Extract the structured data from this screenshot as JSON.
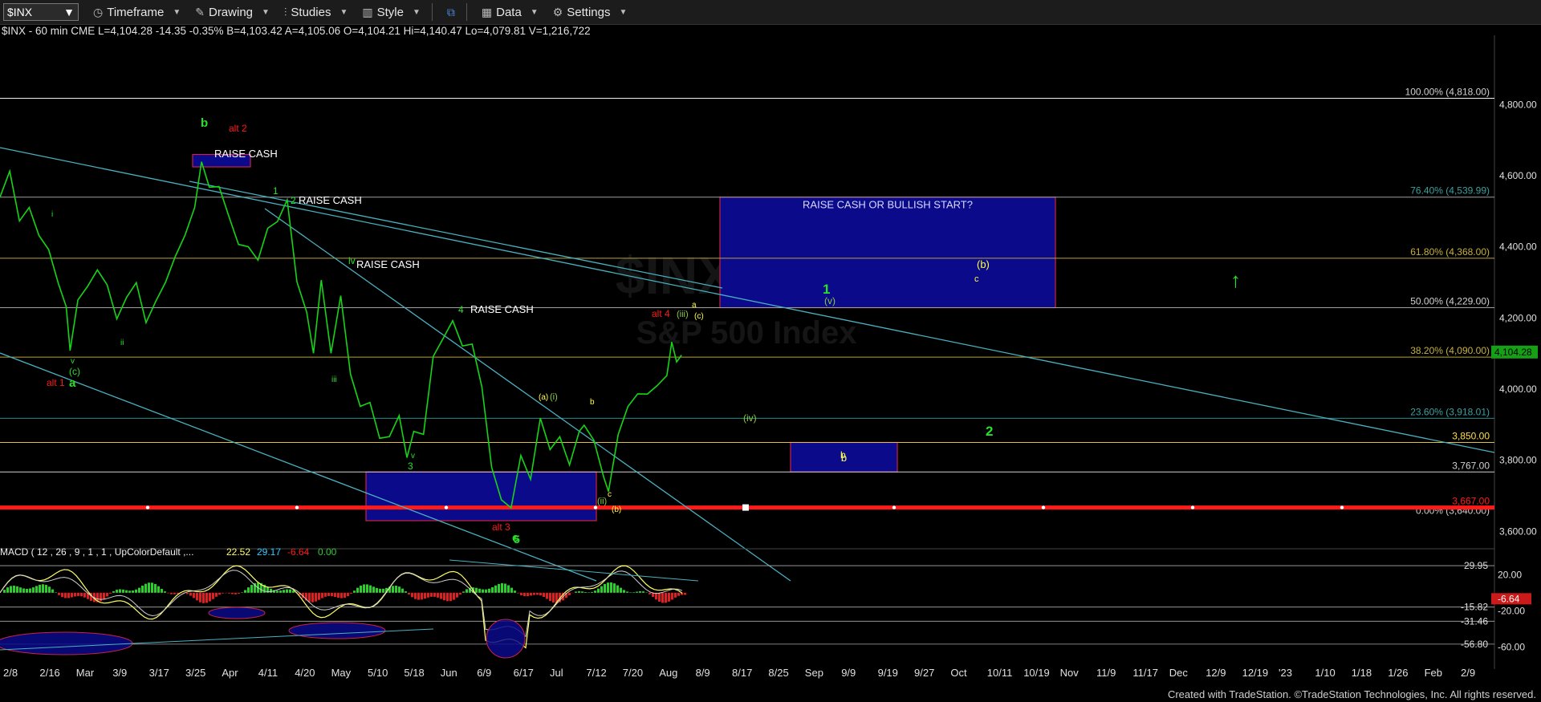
{
  "toolbar": {
    "symbol": "$INX",
    "timeframe": "Timeframe",
    "drawing": "Drawing",
    "studies": "Studies",
    "style": "Style",
    "data": "Data",
    "settings": "Settings"
  },
  "info_line": "$INX - 60 min  CME  L=4,104.28  -14.35  -0.35%  B=4,103.42  A=4,105.06  O=4,104.21  Hi=4,140.47  Lo=4,079.81  V=1,216,722",
  "watermark": {
    "symbol": "$INX",
    "name": "S&P 500 Index"
  },
  "footer": "Created with TradeStation. ©TradeStation Technologies, Inc. All rights reserved.",
  "colors": {
    "price": "#16d416",
    "fib": "#c9c9c9",
    "support": "#ffffff",
    "red": "#ff1a1a",
    "cyan": "#4ab0c0",
    "box": "#0a0a8a",
    "macd": "#e0d060",
    "hist_up": "#2bd02b",
    "hist_dn": "#e02020"
  },
  "chart_data": {
    "type": "line",
    "price_series": [
      [
        0,
        4540
      ],
      [
        10,
        4600
      ],
      [
        20,
        4480
      ],
      [
        30,
        4520
      ],
      [
        40,
        4420
      ],
      [
        50,
        4390
      ],
      [
        60,
        4310
      ],
      [
        68,
        4240
      ],
      [
        72,
        4110
      ],
      [
        80,
        4240
      ],
      [
        90,
        4300
      ],
      [
        100,
        4340
      ],
      [
        110,
        4280
      ],
      [
        120,
        4200
      ],
      [
        130,
        4270
      ],
      [
        140,
        4290
      ],
      [
        150,
        4180
      ],
      [
        160,
        4260
      ],
      [
        170,
        4300
      ],
      [
        180,
        4360
      ],
      [
        190,
        4440
      ],
      [
        200,
        4520
      ],
      [
        207,
        4640
      ],
      [
        215,
        4580
      ],
      [
        225,
        4560
      ],
      [
        235,
        4480
      ],
      [
        245,
        4420
      ],
      [
        255,
        4400
      ],
      [
        265,
        4350
      ],
      [
        275,
        4460
      ],
      [
        285,
        4480
      ],
      [
        295,
        4520
      ],
      [
        305,
        4300
      ],
      [
        315,
        4230
      ],
      [
        322,
        4110
      ],
      [
        330,
        4320
      ],
      [
        340,
        4100
      ],
      [
        350,
        4250
      ],
      [
        360,
        4050
      ],
      [
        370,
        3960
      ],
      [
        380,
        3950
      ],
      [
        390,
        3860
      ],
      [
        400,
        3880
      ],
      [
        410,
        3920
      ],
      [
        418,
        3815
      ],
      [
        425,
        3880
      ],
      [
        435,
        3860
      ],
      [
        445,
        4100
      ],
      [
        455,
        4150
      ],
      [
        465,
        4180
      ],
      [
        475,
        4120
      ],
      [
        485,
        4140
      ],
      [
        495,
        4000
      ],
      [
        505,
        3770
      ],
      [
        515,
        3700
      ],
      [
        525,
        3670
      ],
      [
        535,
        3800
      ],
      [
        545,
        3750
      ],
      [
        555,
        3930
      ],
      [
        565,
        3820
      ],
      [
        575,
        3860
      ],
      [
        585,
        3800
      ],
      [
        595,
        3880
      ],
      [
        600,
        3910
      ],
      [
        610,
        3860
      ],
      [
        620,
        3740
      ],
      [
        625,
        3720
      ],
      [
        635,
        3860
      ],
      [
        645,
        3950
      ],
      [
        655,
        4000
      ],
      [
        665,
        3980
      ],
      [
        675,
        4000
      ],
      [
        685,
        4050
      ],
      [
        690,
        4120
      ],
      [
        695,
        4080
      ],
      [
        700,
        4104
      ]
    ],
    "fib_levels": [
      {
        "label": "100.00% (4,818.00)",
        "value": 4818
      },
      {
        "label": "76.40% (4,539.99)",
        "value": 4540
      },
      {
        "label": "61.80% (4,368.00)",
        "value": 4368
      },
      {
        "label": "50.00% (4,229.00)",
        "value": 4229
      },
      {
        "label": "38.20% (4,090.00)",
        "value": 4090
      },
      {
        "label": "23.60% (3,918.01)",
        "value": 3918
      },
      {
        "label": "0.00% (3,640.00)",
        "value": 3640
      }
    ],
    "support_levels": [
      {
        "label": "3,850.00",
        "value": 3850
      },
      {
        "label": "3,767.00",
        "value": 3767
      },
      {
        "label": "3,667.00",
        "value": 3667
      }
    ],
    "y_ticks": [
      "4,800.00",
      "4,600.00",
      "4,400.00",
      "4,200.00",
      "4,000.00",
      "3,800.00",
      "3,600.00"
    ],
    "y_tick_values": [
      4800,
      4600,
      4400,
      4200,
      4000,
      3800,
      3600
    ],
    "ylim": [
      3560,
      4950
    ],
    "last_price": "4,104.28",
    "x_ticks": [
      "2/8",
      "2/16",
      "Mar",
      "3/9",
      "3/17",
      "3/25",
      "Apr",
      "4/11",
      "4/20",
      "May",
      "5/10",
      "5/18",
      "Jun",
      "6/9",
      "6/17",
      "Jul",
      "7/12",
      "7/20",
      "Aug",
      "8/9",
      "8/17",
      "8/25",
      "Sep",
      "9/9",
      "9/19",
      "9/27",
      "Oct",
      "10/11",
      "10/19",
      "Nov",
      "11/9",
      "11/17",
      "Dec",
      "12/9",
      "12/19",
      "'23",
      "1/10",
      "1/18",
      "1/26",
      "Feb",
      "2/9"
    ],
    "boxes": [
      {
        "label": "RAISE CASH OR BULLISH START?",
        "hi": 4540,
        "lo": 4229
      },
      {
        "label": "b",
        "hi": 3850,
        "lo": 3767
      },
      {
        "label": "",
        "hi": 3767,
        "lo": 3630
      },
      {
        "label": "",
        "hi": 4660,
        "lo": 4625
      }
    ],
    "annotations": [
      "RAISE CASH",
      "RAISE CASH",
      "RAISE CASH",
      "RAISE CASH",
      "1",
      "2",
      "(b)",
      "c",
      "(v)",
      "(iv)",
      "b",
      "alt 1",
      "alt 2",
      "alt 3",
      "alt 4",
      "a",
      "b",
      "c",
      "(c)",
      "v",
      "1",
      "2",
      "3",
      "4",
      "5",
      "i",
      "ii",
      "iii",
      "iv",
      "v",
      "(i)",
      "(ii)",
      "(iii)",
      "(a)",
      "(b)",
      "(c)"
    ],
    "macd": {
      "label": "MACD ( 12 , 26 , 9 , 1 , 1 , UpColorDefault ,...",
      "values": [
        "22.52",
        "29.17",
        "-6.64",
        "0.00"
      ],
      "levels": [
        "29.95",
        "20.00",
        "-15.82",
        "-20.00",
        "-31.46",
        "-56.80",
        "-60.00"
      ],
      "level_values": [
        29.95,
        20,
        -15.82,
        -20,
        -31.46,
        -56.8,
        -60
      ],
      "current": "-6.64",
      "ylim": [
        -72,
        38
      ]
    }
  }
}
